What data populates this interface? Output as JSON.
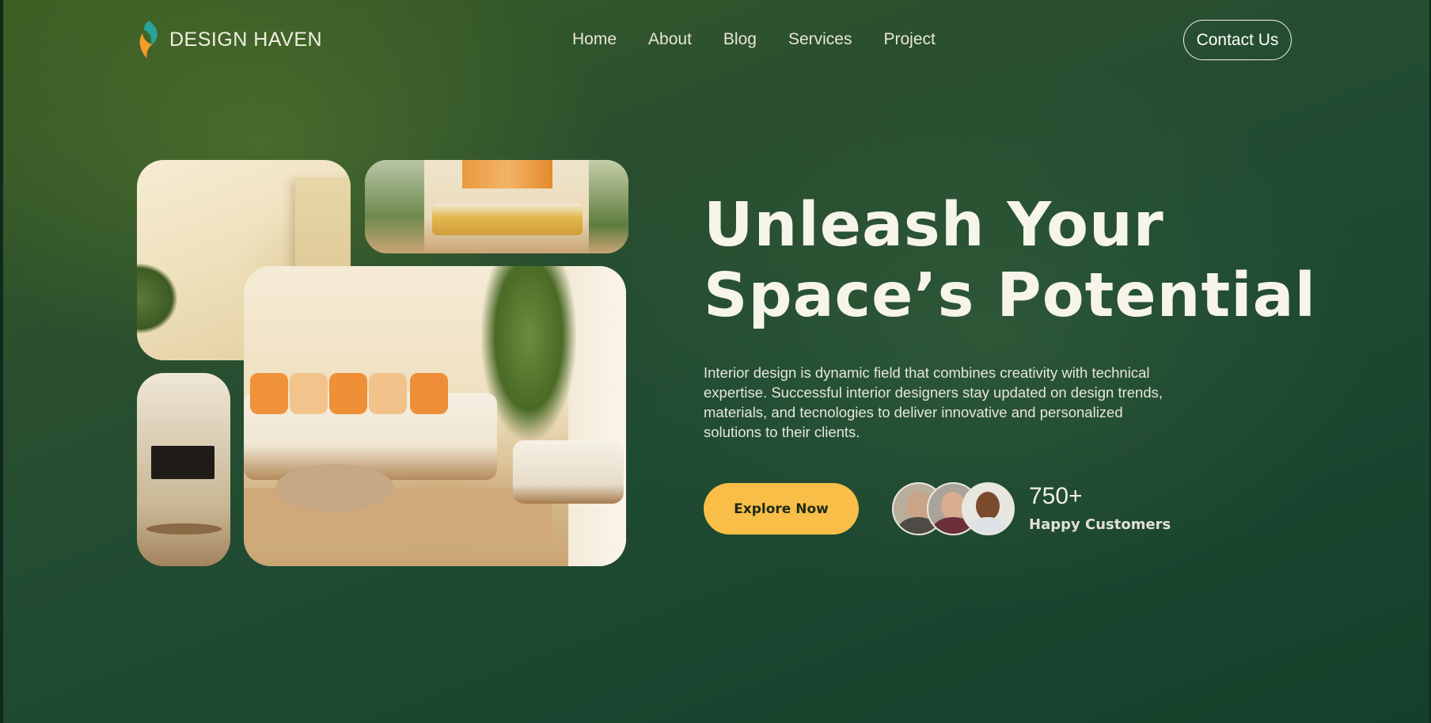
{
  "brand": {
    "name": "DESIGN HAVEN",
    "logo_icon": "leaf-flame-icon",
    "logo_colors": [
      "#2aa49a",
      "#f29b2b"
    ]
  },
  "nav": {
    "items": [
      {
        "label": "Home"
      },
      {
        "label": "About"
      },
      {
        "label": "Blog"
      },
      {
        "label": "Services"
      },
      {
        "label": "Project"
      }
    ],
    "contact_label": "Contact Us"
  },
  "hero": {
    "headline_line1": "Unleash Your",
    "headline_line2": "Space’s Potential",
    "description": "Interior design is dynamic field that combines creativity with technical expertise. Successful interior designers stay updated on design trends, materials, and tecnologies to deliver innovative and personalized solutions to their clients.",
    "cta_label": "Explore Now",
    "cta_color": "#f8be47",
    "stat_value": "750+",
    "stat_label": "Happy Customers"
  },
  "gallery": [
    {
      "name": "living-room-corner-photo"
    },
    {
      "name": "bedroom-photo"
    },
    {
      "name": "tv-room-photo"
    },
    {
      "name": "living-room-sofa-photo"
    }
  ],
  "colors": {
    "background": "#1f4a33",
    "accent": "#f8be47",
    "text": "#f7f4ea"
  }
}
